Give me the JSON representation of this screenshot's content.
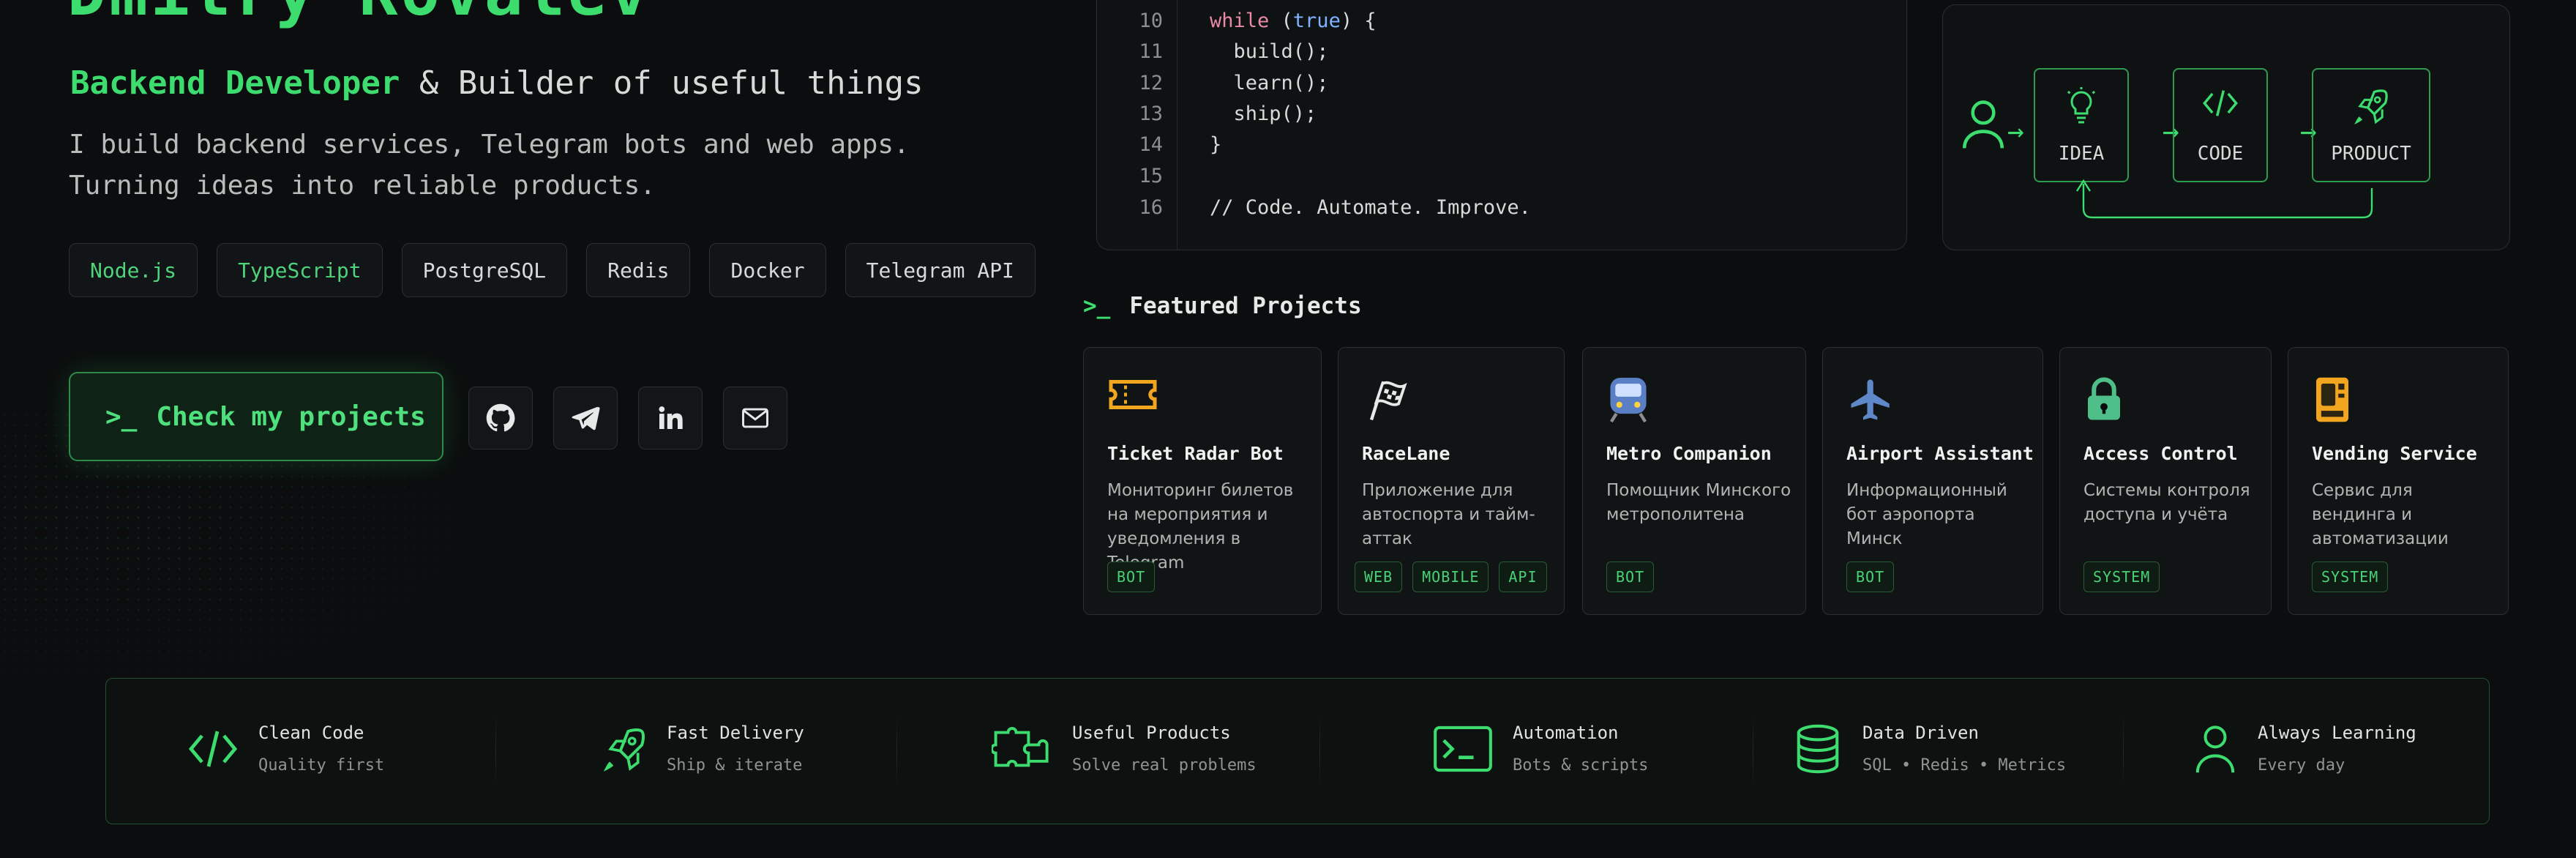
{
  "hero": {
    "title": "Dmitry Kovalev",
    "role_accent": "Backend Developer",
    "role_rest": " & Builder of useful things",
    "bio": "I build backend services, Telegram bots and web apps.\nTurning ideas into reliable products.",
    "tags": [
      "Node.js",
      "TypeScript",
      "PostgreSQL",
      "Redis",
      "Docker",
      "Telegram API"
    ],
    "cta_prompt": ">_",
    "cta_label": "Check my projects",
    "socials": [
      "github-icon",
      "telegram-icon",
      "linkedin-icon",
      "mail-icon"
    ]
  },
  "code": {
    "lines": [
      {
        "n": "10",
        "text": "while (true) {"
      },
      {
        "n": "11",
        "text": "  build();"
      },
      {
        "n": "12",
        "text": "  learn();"
      },
      {
        "n": "13",
        "text": "  ship();"
      },
      {
        "n": "14",
        "text": "}"
      },
      {
        "n": "15",
        "text": ""
      },
      {
        "n": "16",
        "text": "// Code. Automate. Improve."
      }
    ]
  },
  "flow": {
    "steps": [
      "IDEA",
      "CODE",
      "PRODUCT"
    ]
  },
  "featured": {
    "prompt": ">_",
    "heading": "Featured Projects",
    "projects": [
      {
        "icon": "ticket-icon",
        "title": "Ticket Radar Bot",
        "desc": "Мониторинг билетов на мероприятия и уведомления в Telegram",
        "badges": [
          "BOT"
        ]
      },
      {
        "icon": "racing-flag-icon",
        "title": "RaceLane",
        "desc": "Приложение для автоспорта и тайм-аттак",
        "badges": [
          "WEB",
          "MOBILE",
          "API"
        ]
      },
      {
        "icon": "metro-train-icon",
        "title": "Metro Companion",
        "desc": "Помощник Минского метрополитена",
        "badges": [
          "BOT"
        ]
      },
      {
        "icon": "airplane-icon",
        "title": "Airport Assistant",
        "desc": "Информационный бот аэропорта Минск",
        "badges": [
          "BOT"
        ]
      },
      {
        "icon": "lock-icon",
        "title": "Access Control",
        "desc": "Системы контроля доступа и учёта",
        "badges": [
          "SYSTEM"
        ]
      },
      {
        "icon": "vending-machine-icon",
        "title": "Vending Service",
        "desc": "Сервис для вендинга и автоматизации",
        "badges": [
          "SYSTEM"
        ]
      }
    ]
  },
  "features": [
    {
      "icon": "code-icon",
      "title": "Clean Code",
      "subtitle": "Quality first"
    },
    {
      "icon": "rocket-icon",
      "title": "Fast Delivery",
      "subtitle": "Ship & iterate"
    },
    {
      "icon": "puzzle-icon",
      "title": "Useful Products",
      "subtitle": "Solve real problems"
    },
    {
      "icon": "terminal-icon",
      "title": "Automation",
      "subtitle": "Bots & scripts"
    },
    {
      "icon": "database-icon",
      "title": "Data Driven",
      "subtitle": "SQL • Redis • Metrics"
    },
    {
      "icon": "user-icon",
      "title": "Always Learning",
      "subtitle": "Every day"
    }
  ],
  "colors": {
    "accent": "#3ddc6f",
    "background": "#0b0d0e",
    "card": "#111415",
    "border": "#2a2f31"
  }
}
